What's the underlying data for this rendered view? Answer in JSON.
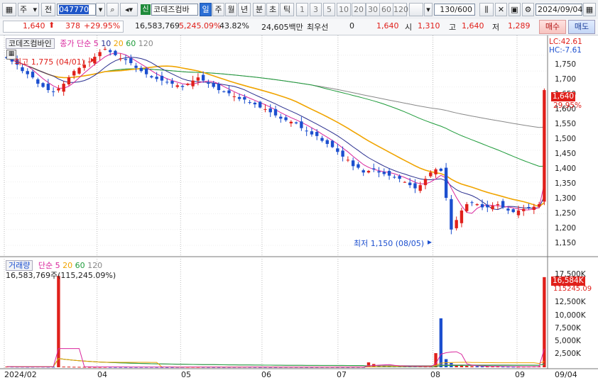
{
  "toolbar": {
    "type_select": "주",
    "market_select": "전",
    "code": "047770",
    "credit_badge": "신",
    "stock_name": "코데즈컴바",
    "periods": [
      "일",
      "주",
      "월",
      "년",
      "분",
      "초",
      "틱"
    ],
    "periods_selected": "일",
    "intervals": [
      "1",
      "3",
      "5",
      "10",
      "20",
      "30",
      "60",
      "120"
    ],
    "count_value": "130/600",
    "date_value": "2024/09/04"
  },
  "quote": {
    "price": "1,640",
    "change": "378",
    "change_pct": "+29.95%",
    "volume": "16,583,769",
    "volume_ratio": "5,245.09%",
    "turnover_pct": "43.82%",
    "trade_value": "24,605백만",
    "preferred_label": "최우선",
    "preferred_value": "0",
    "last": "1,640",
    "open_label": "시",
    "open": "1,310",
    "high_label": "고",
    "high": "1,640",
    "low_label": "저",
    "low": "1,289",
    "buy_button": "매수",
    "sell_button": "매도"
  },
  "price_chart": {
    "legend_name": "코데즈컴바인",
    "legend_ma": "종가 단순",
    "ma_periods": [
      "5",
      "10",
      "20",
      "60",
      "120"
    ],
    "lc": "LC:42.61",
    "hc": "HC:-7.61",
    "high_annotation": "최고 1,775 (04/01)",
    "low_annotation": "최저 1,150 (08/05)",
    "price_tag": "1,640",
    "pct_tag": "29.95%",
    "y_ticks": [
      "1,750",
      "1,700",
      "1,650",
      "1,600",
      "1,550",
      "1,500",
      "1,450",
      "1,400",
      "1,350",
      "1,300",
      "1,250",
      "1,200",
      "1,150"
    ]
  },
  "volume_chart": {
    "legend_name": "거래량",
    "legend_ma": "단순",
    "ma_periods": [
      "5",
      "20",
      "60",
      "120"
    ],
    "info_line": "16,583,769주(115,245.09%)",
    "vol_tag": "16,584K",
    "pct_tag": "115245.09",
    "y_ticks": [
      "17,500K",
      "15,000K",
      "12,500K",
      "10,000K",
      "7,500K",
      "5,000K",
      "2,500K"
    ]
  },
  "x_axis": [
    "2024/02",
    "04",
    "05",
    "06",
    "07",
    "08",
    "09",
    "09/04"
  ],
  "colors": {
    "up": "#e0201b",
    "down": "#1c4fcf",
    "ma5": "#d9269d",
    "ma10": "#2a2f8f",
    "ma20": "#f0a400",
    "ma60": "#1e9b3a",
    "ma120": "#888888"
  },
  "chart_data": {
    "type": "candlestick",
    "y_range": [
      1130,
      1790
    ],
    "closes": [
      1740,
      1730,
      1720,
      1700,
      1690,
      1680,
      1660,
      1650,
      1640,
      1635,
      1645,
      1660,
      1680,
      1700,
      1710,
      1720,
      1730,
      1745,
      1760,
      1770,
      1760,
      1750,
      1740,
      1735,
      1725,
      1710,
      1700,
      1690,
      1680,
      1675,
      1670,
      1665,
      1660,
      1655,
      1650,
      1660,
      1670,
      1680,
      1670,
      1660,
      1650,
      1640,
      1635,
      1630,
      1620,
      1612,
      1610,
      1600,
      1595,
      1585,
      1580,
      1570,
      1560,
      1550,
      1545,
      1540,
      1535,
      1520,
      1510,
      1500,
      1495,
      1480,
      1470,
      1460,
      1445,
      1430,
      1420,
      1400,
      1395,
      1380,
      1385,
      1390,
      1380,
      1375,
      1370,
      1365,
      1360,
      1350,
      1340,
      1330,
      1340,
      1360,
      1380,
      1390,
      1385,
      1300,
      1200,
      1230,
      1260,
      1280,
      1285,
      1280,
      1270,
      1270,
      1275,
      1280,
      1270,
      1260,
      1255,
      1260,
      1265,
      1270,
      1272,
      1280,
      1640
    ],
    "volumes_k": [
      120,
      110,
      100,
      100,
      90,
      95,
      110,
      100,
      90,
      85,
      16800,
      120,
      110,
      90,
      80,
      70,
      60,
      55,
      60,
      70,
      65,
      60,
      60,
      55,
      50,
      50,
      55,
      60,
      60,
      50,
      45,
      40,
      40,
      45,
      50,
      60,
      65,
      55,
      50,
      45,
      40,
      40,
      35,
      40,
      45,
      50,
      55,
      50,
      45,
      40,
      40,
      35,
      30,
      35,
      40,
      45,
      40,
      35,
      30,
      30,
      35,
      40,
      45,
      40,
      35,
      30,
      30,
      35,
      40,
      45,
      900,
      600,
      400,
      300,
      250,
      200,
      180,
      160,
      150,
      140,
      130,
      120,
      120,
      2600,
      9000,
      1500,
      800,
      400,
      300,
      250,
      200,
      180,
      160,
      150,
      140,
      130,
      120,
      110,
      100,
      100,
      110,
      120,
      130,
      150,
      16584
    ]
  }
}
